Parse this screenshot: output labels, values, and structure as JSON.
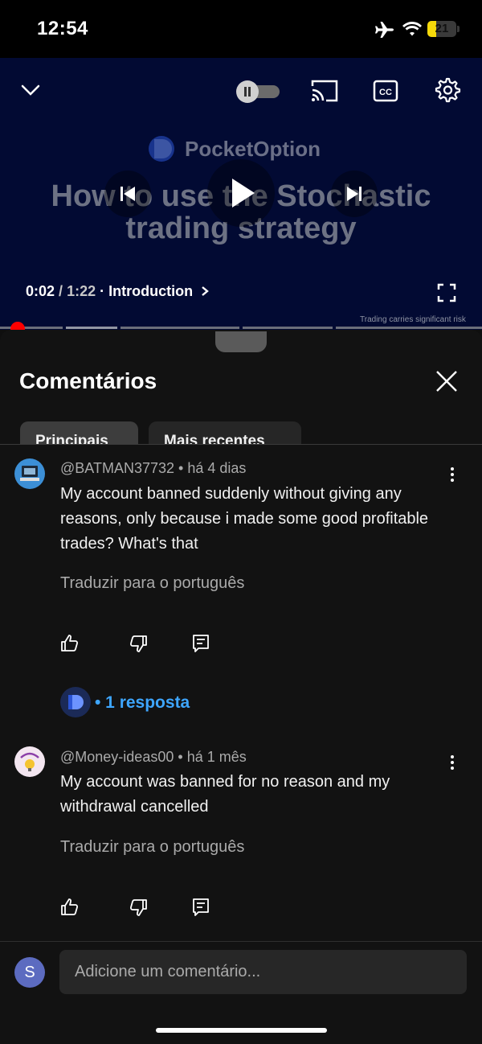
{
  "status_bar": {
    "time": "12:54",
    "battery": "21"
  },
  "video": {
    "brand": "PocketOption",
    "title_line1": "How to use the Stochastic",
    "title_line2": "trading strategy",
    "current_time": "0:02",
    "separator": "/",
    "duration": "1:22",
    "chapter": "Introduction",
    "disclaimer": "Trading carries significant risk",
    "progress_fraction": 0.015
  },
  "panel": {
    "title": "Comentários",
    "chips": [
      "Principais",
      "Mais recentes"
    ],
    "comments": [
      {
        "author": "@BATMAN37732",
        "age": "há 4 dias",
        "text": "My account banned suddenly without giving any reasons, only because i made some good profitable trades? What's that",
        "translate": "Traduzir para o português"
      },
      {
        "author": "@Money-ideas00",
        "age": "há 1 mês",
        "text": "My account was banned for no reason and my withdrawal cancelled",
        "translate": "Traduzir para o português"
      }
    ],
    "replies": "• 1 resposta",
    "composer": {
      "avatar_letter": "S",
      "placeholder": "Adicione um comentário..."
    }
  },
  "colors": {
    "accent_link": "#3ea6ff",
    "playhead": "#ff0000",
    "video_bg": "#020a33"
  }
}
